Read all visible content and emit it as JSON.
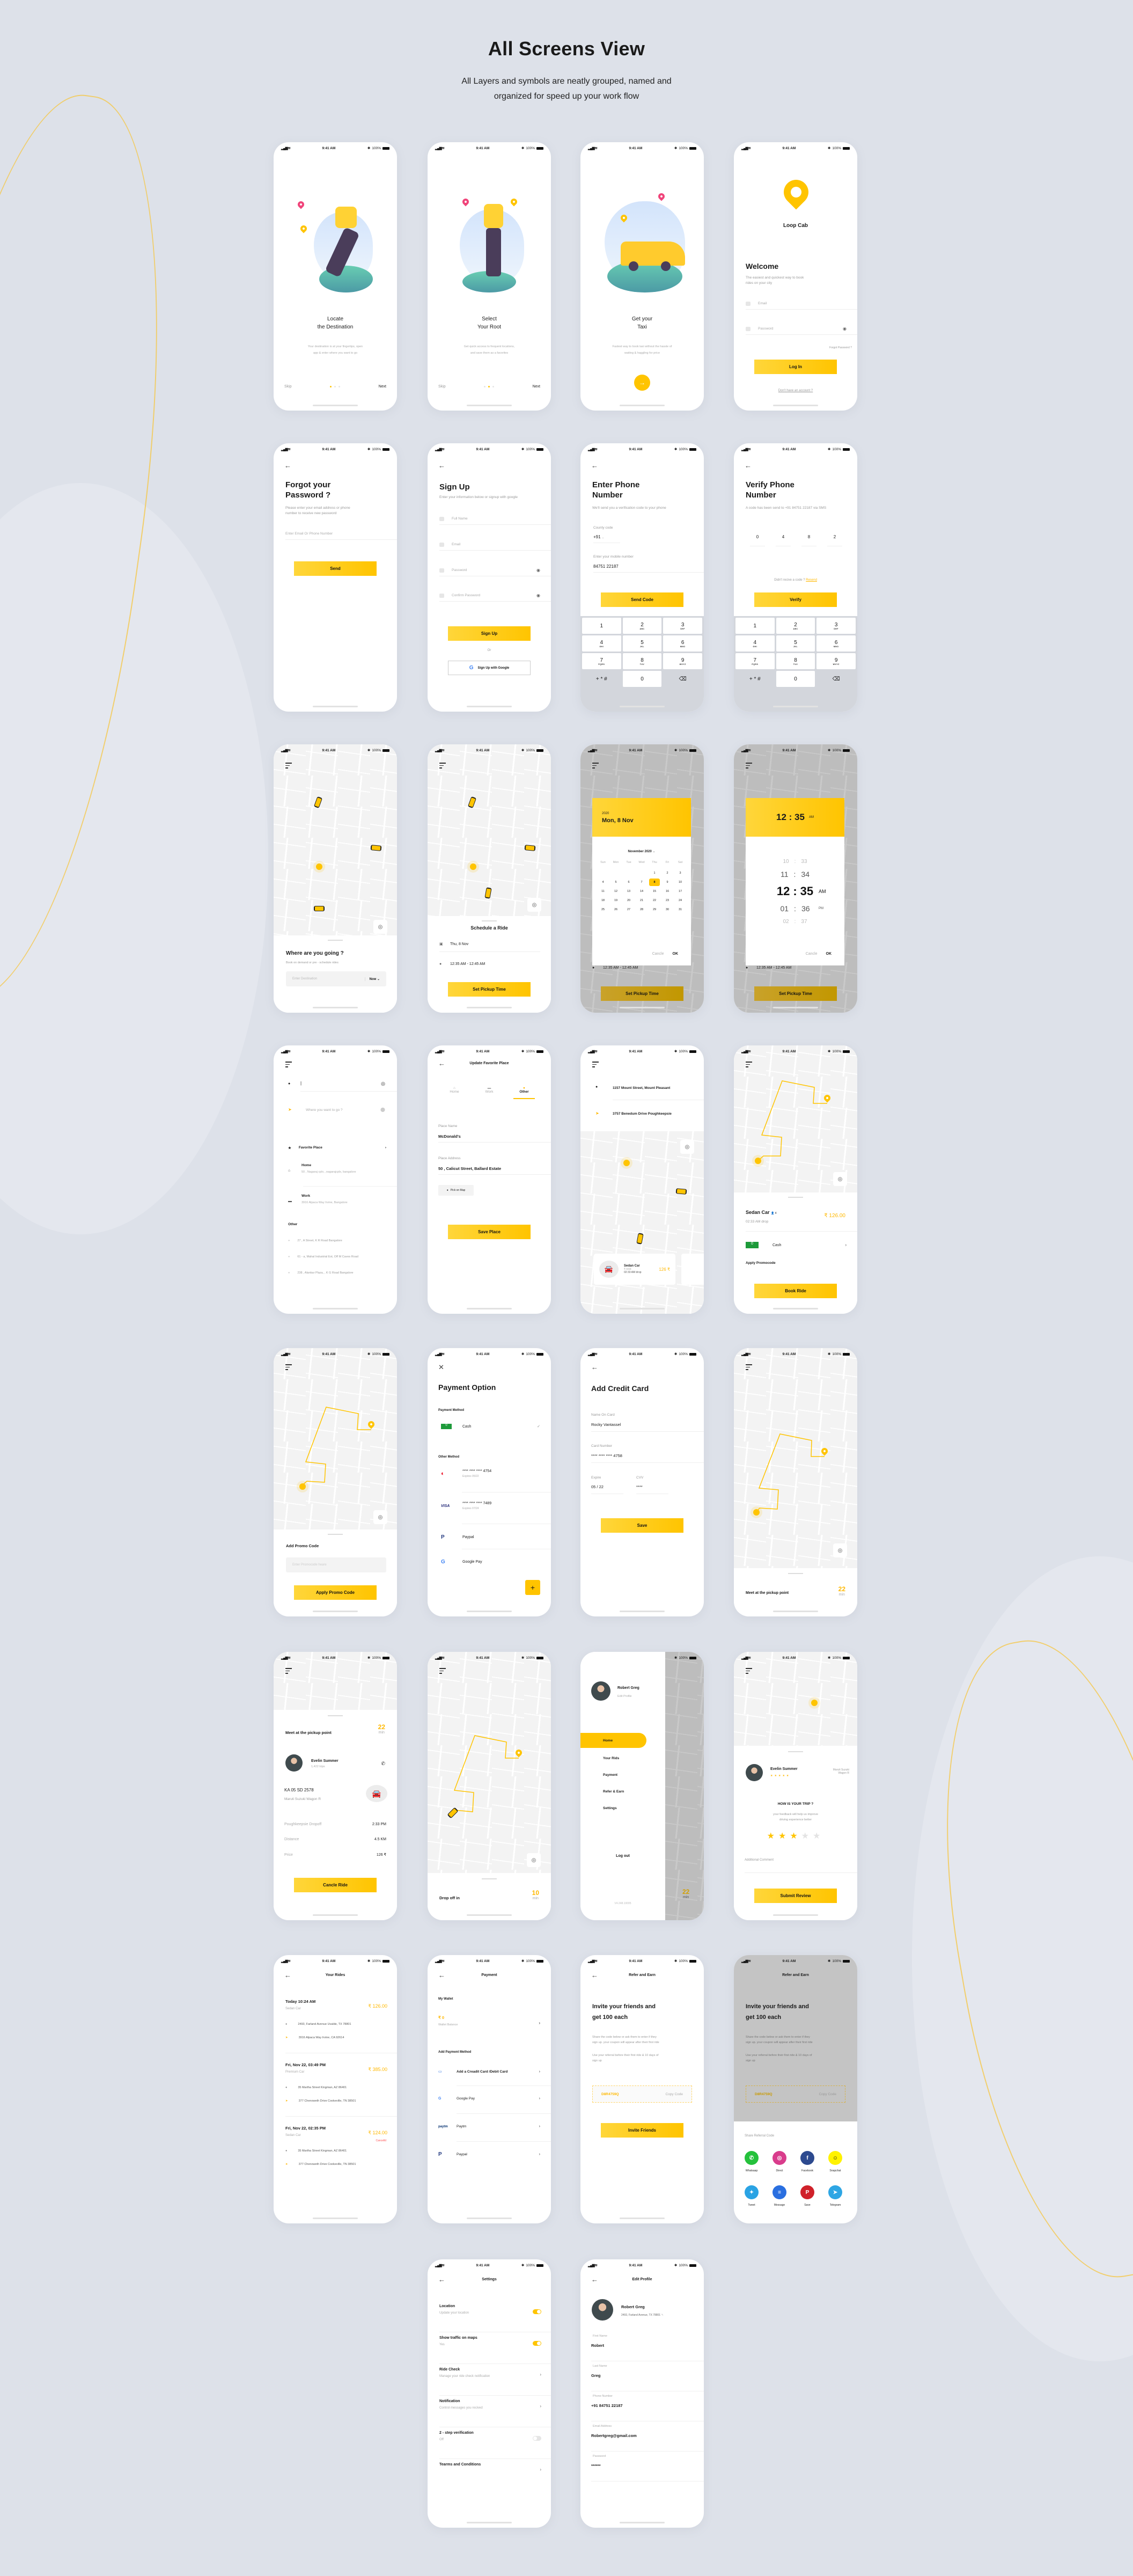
{
  "header": {
    "title": "All Screens View",
    "subtitle_line1": "All Layers and symbols are neatly grouped, named and",
    "subtitle_line2": "organized for speed up your work flow"
  },
  "status": {
    "time": "9:41 AM",
    "battery": "100%"
  },
  "colors": {
    "accent": "#ffc400",
    "background": "#dde1e9",
    "danger": "#ff4d4f"
  },
  "onboarding": [
    {
      "title1": "Locate",
      "title2": "the Destination",
      "text1": "Your destination is at your fingertips, open",
      "text2": "app & enter where you want to go",
      "skip": "Skip",
      "next": "Next",
      "active_dot": 1
    },
    {
      "title1": "Select",
      "title2": "Your Root",
      "text1": "Get quick access to frequent locations,",
      "text2": "and save them as a favorites",
      "skip": "Skip",
      "next": "Next",
      "active_dot": 2
    },
    {
      "title1": "Get your",
      "title2": "Taxi",
      "text1": "Fastest way to book taxi without the hassle of",
      "text2": "waiting & haggling for price",
      "next_icon": "arrow-right-icon"
    }
  ],
  "login": {
    "brand": "Loop Cab",
    "title": "Welcome",
    "text1": "The easiest and quickest way to book",
    "text2": "rides on your city",
    "email_placeholder": "Email",
    "password_placeholder": "Password",
    "forgot": "Forgot Password ?",
    "button": "Log In",
    "signup_link": "Don't have an account ?"
  },
  "forgot": {
    "title1": "Forgot your",
    "title2": "Password ?",
    "text1": "Please enter your email address or phone",
    "text2": "number to receive new password",
    "placeholder": "Enter Email Or Phone Number",
    "button": "Send"
  },
  "signup": {
    "title": "Sign Up",
    "text": "Enter your information below or signup with google",
    "fields": [
      "Full Name",
      "Email",
      "Password",
      "Confirm Password"
    ],
    "button": "Sign Up",
    "or": "Or",
    "google": "Sign Up with Google"
  },
  "enter_phone": {
    "title1": "Enter Phone",
    "title2": "Number",
    "text": "We'll send you a verification code to your phone",
    "country_label": "County code",
    "country_value": "+91",
    "mobile_label": "Enter your mobile number",
    "mobile_value": "84751  22187",
    "button": "Send Code"
  },
  "verify_phone": {
    "title1": "Verify Phone",
    "title2": "Number",
    "text": "A code has been send to +91 84751 22187 via SMS",
    "digits": [
      "0",
      "4",
      "8",
      "2"
    ],
    "resend_text": "Didn't recive a code ?",
    "resend_link": "Resend",
    "button": "Verify"
  },
  "keypad": [
    {
      "n": "1",
      "l": ""
    },
    {
      "n": "2",
      "l": "ABC"
    },
    {
      "n": "3",
      "l": "DEF"
    },
    {
      "n": "4",
      "l": "GHI"
    },
    {
      "n": "5",
      "l": "JKL"
    },
    {
      "n": "6",
      "l": "MNO"
    },
    {
      "n": "7",
      "l": "PQRS"
    },
    {
      "n": "8",
      "l": "TUV"
    },
    {
      "n": "9",
      "l": "WXYZ"
    },
    {
      "n": "+ * #",
      "l": ""
    },
    {
      "n": "0",
      "l": ""
    },
    {
      "n": "⌫",
      "l": ""
    }
  ],
  "home": {
    "title": "Where are you going ?",
    "text": "Book on demand or pre - schedule rides",
    "placeholder": "Enter Destination",
    "when": "Now"
  },
  "schedule": {
    "title": "Schedule a Ride",
    "date": "Thu, 8 Nov",
    "time": "12:35 AM - 12:45 AM",
    "button": "Set Pickup Time"
  },
  "datepicker": {
    "year": "2020",
    "date": "Mon, 8 Nov",
    "month": "November 2020",
    "weekdays": [
      "Sun",
      "Mon",
      "Tue",
      "Wed",
      "Thu",
      "Fri",
      "Sat"
    ],
    "days": [
      "",
      "",
      "",
      "",
      "1",
      "2",
      "3",
      "4",
      "5",
      "6",
      "7",
      "8",
      "9",
      "10",
      "11",
      "12",
      "13",
      "14",
      "15",
      "16",
      "17",
      "18",
      "19",
      "20",
      "21",
      "22",
      "23",
      "24",
      "25",
      "26",
      "27",
      "28",
      "29",
      "30",
      "31"
    ],
    "selected": "8",
    "cancel": "Cancle",
    "ok": "OK"
  },
  "timepicker": {
    "time": "12 : 35",
    "ampm": "AM",
    "rows": [
      {
        "h": "10",
        "m": "33",
        "p": ""
      },
      {
        "h": "11",
        "m": "34",
        "p": ""
      },
      {
        "h": "12",
        "m": "35",
        "p": "AM"
      },
      {
        "h": "01",
        "m": "36",
        "p": "PM"
      },
      {
        "h": "02",
        "m": "37",
        "p": ""
      }
    ],
    "cancel": "Cancle",
    "ok": "OK"
  },
  "search": {
    "placeholder": "Where you want to go ?",
    "favorite": "Favorite Place",
    "home_label": "Home",
    "home_addr": "50 , Nagaraj cplx, ,nagarajcplx, bangalore",
    "work_label": "Work",
    "work_addr": "3916 Alpaca Way Irvine, Bangalore",
    "other_label": "Other",
    "others": [
      "27 , A Street, K R Road Bangalore",
      "61 - a, Mahal Industrial Est, Off M Caves Road",
      "238 , Alankar Plaza, , K G Road Bangalore"
    ]
  },
  "update_place": {
    "title": "Update Favorite Place",
    "tabs": [
      "Home",
      "Work",
      "Other"
    ],
    "active_tab": "Other",
    "name_label": "Place Name",
    "name_value": "McDonald's",
    "addr_label": "Place Address",
    "addr_value": "50 , Calicut Street, Ballard Estate",
    "pick_map": "Pick on Map",
    "button": "Save Place"
  },
  "select_car": {
    "from": "1157 Mount Street, Mount Pleasant",
    "to": "3757 Benedum Drive Poughkeepsie",
    "car": "Sedan Car",
    "seats": "4 seat",
    "drop": "02:33 AM drop",
    "price": "126 ₹"
  },
  "book": {
    "car": "Sedan Car",
    "seats": "4",
    "drop": "02:33 AM drop",
    "price": "₹ 126.00",
    "pay": "Cash",
    "promo": "Apply Promocode",
    "button": "Book Ride"
  },
  "promo": {
    "title": "Add Promo Code",
    "placeholder": "Enter Promocode heare",
    "button": "Apply Promo Code"
  },
  "payment_option": {
    "title": "Payment Option",
    "method_label": "Payment Method",
    "cash": "Cash",
    "other_label": "Other Method",
    "cards": [
      {
        "brand": "mastercard",
        "num": "**** **** ****  4754",
        "exp": "Expires 05/22"
      },
      {
        "brand": "VISA",
        "num": "**** **** ****  7489",
        "exp": "Expires 07/24"
      }
    ],
    "paypal": "Paypal",
    "gpay": "Google Pay",
    "add": "+"
  },
  "credit_card": {
    "title": "Add Credit Card",
    "name_label": "Name On Card",
    "name_value": "Rocky  Vantassel",
    "num_label": "Card Number",
    "num_value": "**** **** ****  4758",
    "exp_label": "Expire",
    "exp_value": "05 / 22",
    "cvv_label": "CVV",
    "cvv_value": "****",
    "button": "Save"
  },
  "meet": {
    "text": "Meet at the pickup point",
    "eta": "22",
    "unit": "min"
  },
  "ride_detail": {
    "text": "Meet at the pickup point",
    "eta": "22",
    "unit": "min",
    "driver": "Evelin  Summer",
    "trips": "1,422 trips",
    "plate": "KA 05 SD 2578",
    "model": "Maruti Suzuki Wagon R",
    "rows": [
      {
        "k": "Poughkeepsie Dropoff",
        "v": "2:33 PM"
      },
      {
        "k": "Distance",
        "v": "4.5 KM"
      },
      {
        "k": "Price",
        "v": "126 ₹"
      }
    ],
    "button": "Cancle Ride"
  },
  "dropoff": {
    "text": "Drop off in",
    "eta": "10",
    "unit": "min"
  },
  "drawer": {
    "name": "Robert  Greg",
    "edit": "Edit Profile",
    "items": [
      "Home",
      "Your Rids",
      "Payment",
      "Refer & Earn",
      "Settings"
    ],
    "active": "Home",
    "logout": "Log out",
    "version": "V4.248.10005",
    "eta": "22",
    "unit": "min"
  },
  "review": {
    "driver": "Evelin  Summer",
    "car1": "Maruti Suzuki",
    "car2": "Wagon R",
    "question": "HOW  IS YOUR TRIP  ?",
    "text1": "your feedback will help us improve",
    "text2": "driving experience better",
    "rating": 3,
    "max_rating": 5,
    "comment": "Additional Comment",
    "button": "Submit Review"
  },
  "rides": {
    "title": "Your Rides",
    "items": [
      {
        "when": "Today 10:24 AM",
        "car": "Sedan Car",
        "price": "₹ 126.00",
        "from": "2493, Farland Avenue Uvalde, TX 78801",
        "to": "3916 Alpaca Way Irvine, CA 92614",
        "status": ""
      },
      {
        "when": "Fri, Nov 22, 03:49 PM",
        "car": "Premium Car",
        "price": "₹ 385.00",
        "from": "35 Martha Street Kingman, AZ 86401",
        "to": "377 Chenoweth Drive Cookeville, TN 38501",
        "status": ""
      },
      {
        "when": "Fri, Nov 22, 02:35 PM",
        "car": "Sedan Car",
        "price": "₹ 124.00",
        "from": "35 Martha Street Kingman, AZ 86401",
        "to": "377 Chenoweth Drive Cookeville, TN 38501",
        "status": "Cancelld"
      }
    ]
  },
  "payment": {
    "title": "Payment",
    "wallet_label": "My Wallet",
    "balance": "₹ 0",
    "balance_label": "Wallet Balance",
    "add_label": "Add Payment Method",
    "methods": [
      "Add a Creadit Card /Debit Card",
      "Google Pay",
      "Paytm",
      "Paypal"
    ]
  },
  "refer": {
    "title": "Refer and Earn",
    "head1": "Invite your friends and",
    "head2": "get 100 each",
    "p1a": "Share the code below or ask them to enter if they",
    "p1b": "sign up. your coupon will appear after their first ride",
    "p2a": "Use your referral before their first ride & 10 days of",
    "p2b": "sign up",
    "code": "D8R4759Q",
    "copy": "Copy Code",
    "button": "Invite Friends",
    "share_label": "Share Referral Code",
    "share": [
      {
        "n": "Whatsaap",
        "c": "#25c13c",
        "g": "✆"
      },
      {
        "n": "Direct",
        "c": "#d93c8c",
        "g": "◎"
      },
      {
        "n": "Facebook",
        "c": "#2d4a8f",
        "g": "f"
      },
      {
        "n": "Snapchat",
        "c": "#fff200",
        "g": "☺"
      },
      {
        "n": "Tweet",
        "c": "#2aa3e4",
        "g": "✦"
      },
      {
        "n": "Message",
        "c": "#2a6fe0",
        "g": "≡"
      },
      {
        "n": "Save",
        "c": "#d0212a",
        "g": "P"
      },
      {
        "n": "Telegram",
        "c": "#2ea6e4",
        "g": "➤"
      }
    ]
  },
  "settings": {
    "title": "Settings",
    "items": [
      {
        "t": "Location",
        "s": "Update your location",
        "ctl": "on"
      },
      {
        "t": "Show traffic on maps",
        "s": "Yes",
        "ctl": "on"
      },
      {
        "t": "Ride Check",
        "s": "Manage your ride check notification",
        "ctl": "chev"
      },
      {
        "t": "Notification",
        "s": "Control messages you recived",
        "ctl": "chev"
      },
      {
        "t": "2 - step verification",
        "s": "Off",
        "ctl": "off"
      },
      {
        "t": "Tearms and Conditions",
        "s": "",
        "ctl": "chev"
      }
    ]
  },
  "profile": {
    "title": "Edit Profile",
    "name": "Robert  Greg",
    "addr": "2493, Farland Avenue, TX 78801",
    "fields": [
      {
        "l": "First Name",
        "v": "Robert"
      },
      {
        "l": "Last Name",
        "v": "Greg"
      },
      {
        "l": "Phone Number",
        "v": "+91 84751  22187"
      },
      {
        "l": "Email Address",
        "v": "Robertgreg@gmail.com"
      },
      {
        "l": "Password",
        "v": "******"
      }
    ]
  }
}
